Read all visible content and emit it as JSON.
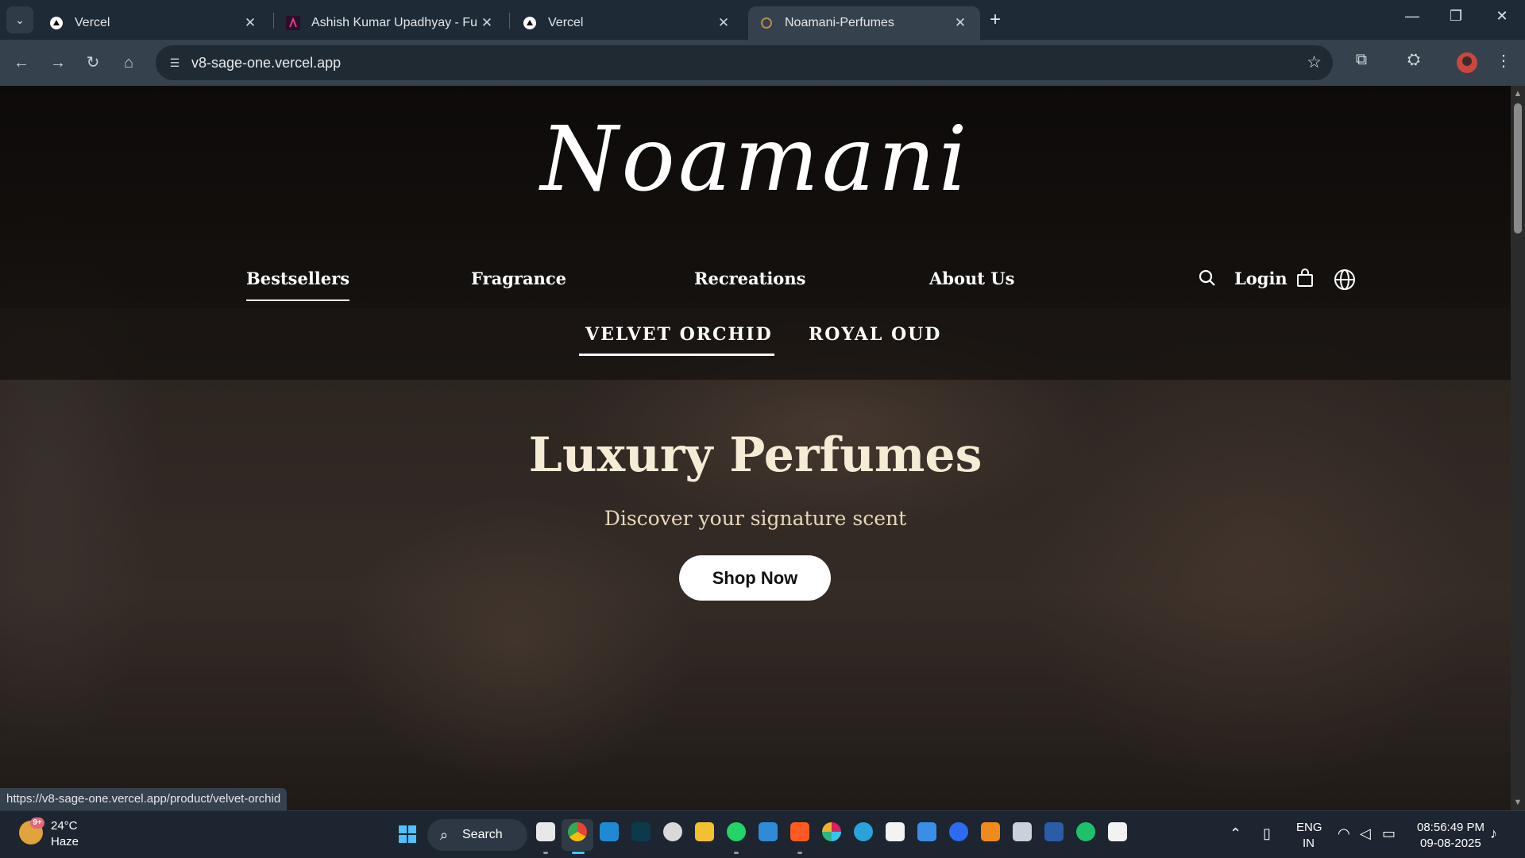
{
  "browser": {
    "tabs": [
      {
        "title": "Vercel",
        "favicon": "vercel-triangle"
      },
      {
        "title": "Ashish Kumar Upadhyay - Full S",
        "favicon": "portfolio-logo"
      },
      {
        "title": "Vercel",
        "favicon": "vercel-triangle"
      },
      {
        "title": "Noamani-Perfumes",
        "favicon": "noamani-logo"
      }
    ],
    "new_tab": "+",
    "url": "v8-sage-one.vercel.app",
    "status_url": "https://v8-sage-one.vercel.app/product/velvet-orchid"
  },
  "site": {
    "brand": "Noamani",
    "nav": [
      "Bestsellers",
      "Fragrance",
      "Recreations",
      "About Us"
    ],
    "login": "Login",
    "subnav": [
      "VELVET ORCHID",
      "ROYAL OUD"
    ],
    "hero_title": "Luxury Perfumes",
    "hero_subtitle": "Discover your signature scent",
    "cta": "Shop Now"
  },
  "taskbar": {
    "weather_temp": "24°C",
    "weather_cond": "Haze",
    "weather_badge": "9+",
    "search": "Search",
    "lang_line1": "ENG",
    "lang_line2": "IN",
    "time": "08:56:49 PM",
    "date": "09-08-2025"
  },
  "colors": {
    "tab_strip": "#1e2a35",
    "toolbar": "#35414d",
    "hero_title": "#f5ecd6",
    "cta_bg": "#ffffff"
  }
}
